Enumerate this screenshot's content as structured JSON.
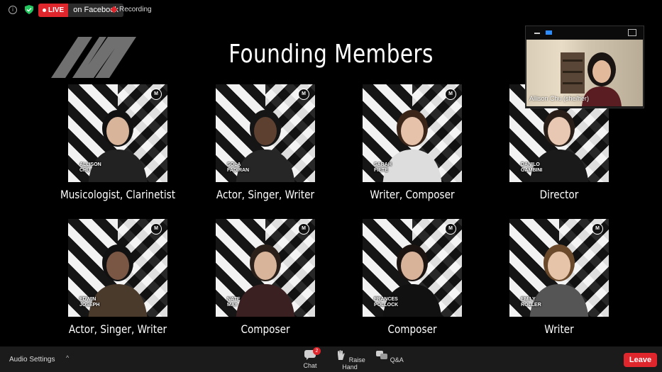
{
  "status": {
    "live_label": "LIVE",
    "live_destination": "on Facebook",
    "recording_label": "Recording",
    "colors": {
      "live_red": "#e0262d",
      "shield_green": "#22c55e"
    }
  },
  "slide": {
    "title": "Founding Members",
    "logo_icon": "mn-stripes-logo",
    "members": [
      {
        "name_tag": "ALLISON\nCHU",
        "role": "Musicologist, Clarinetist"
      },
      {
        "name_tag": "SOLA\nFADIRAN",
        "role": "Actor, Singer, Writer"
      },
      {
        "name_tag": "SARAH\nFIETE",
        "role": "Writer, Composer"
      },
      {
        "name_tag": "DANILO\nGAMBINI",
        "role": "Director"
      },
      {
        "name_tag": "EDWIN\nJOSEPH",
        "role": "Actor, Singer, Writer"
      },
      {
        "name_tag": "NATE\nMAY",
        "role": "Composer"
      },
      {
        "name_tag": "FRANCES\nPOLLOCK",
        "role": "Composer"
      },
      {
        "name_tag": "EMILY\nROLLER",
        "role": "Writer"
      }
    ]
  },
  "video": {
    "participant_name": "Allison Chu (she/her)"
  },
  "bottombar": {
    "audio_settings": "Audio Settings",
    "chat_label": "Chat",
    "chat_count": "2",
    "raise_hand_label": "Raise Hand",
    "qa_label": "Q&A",
    "leave_label": "Leave"
  }
}
